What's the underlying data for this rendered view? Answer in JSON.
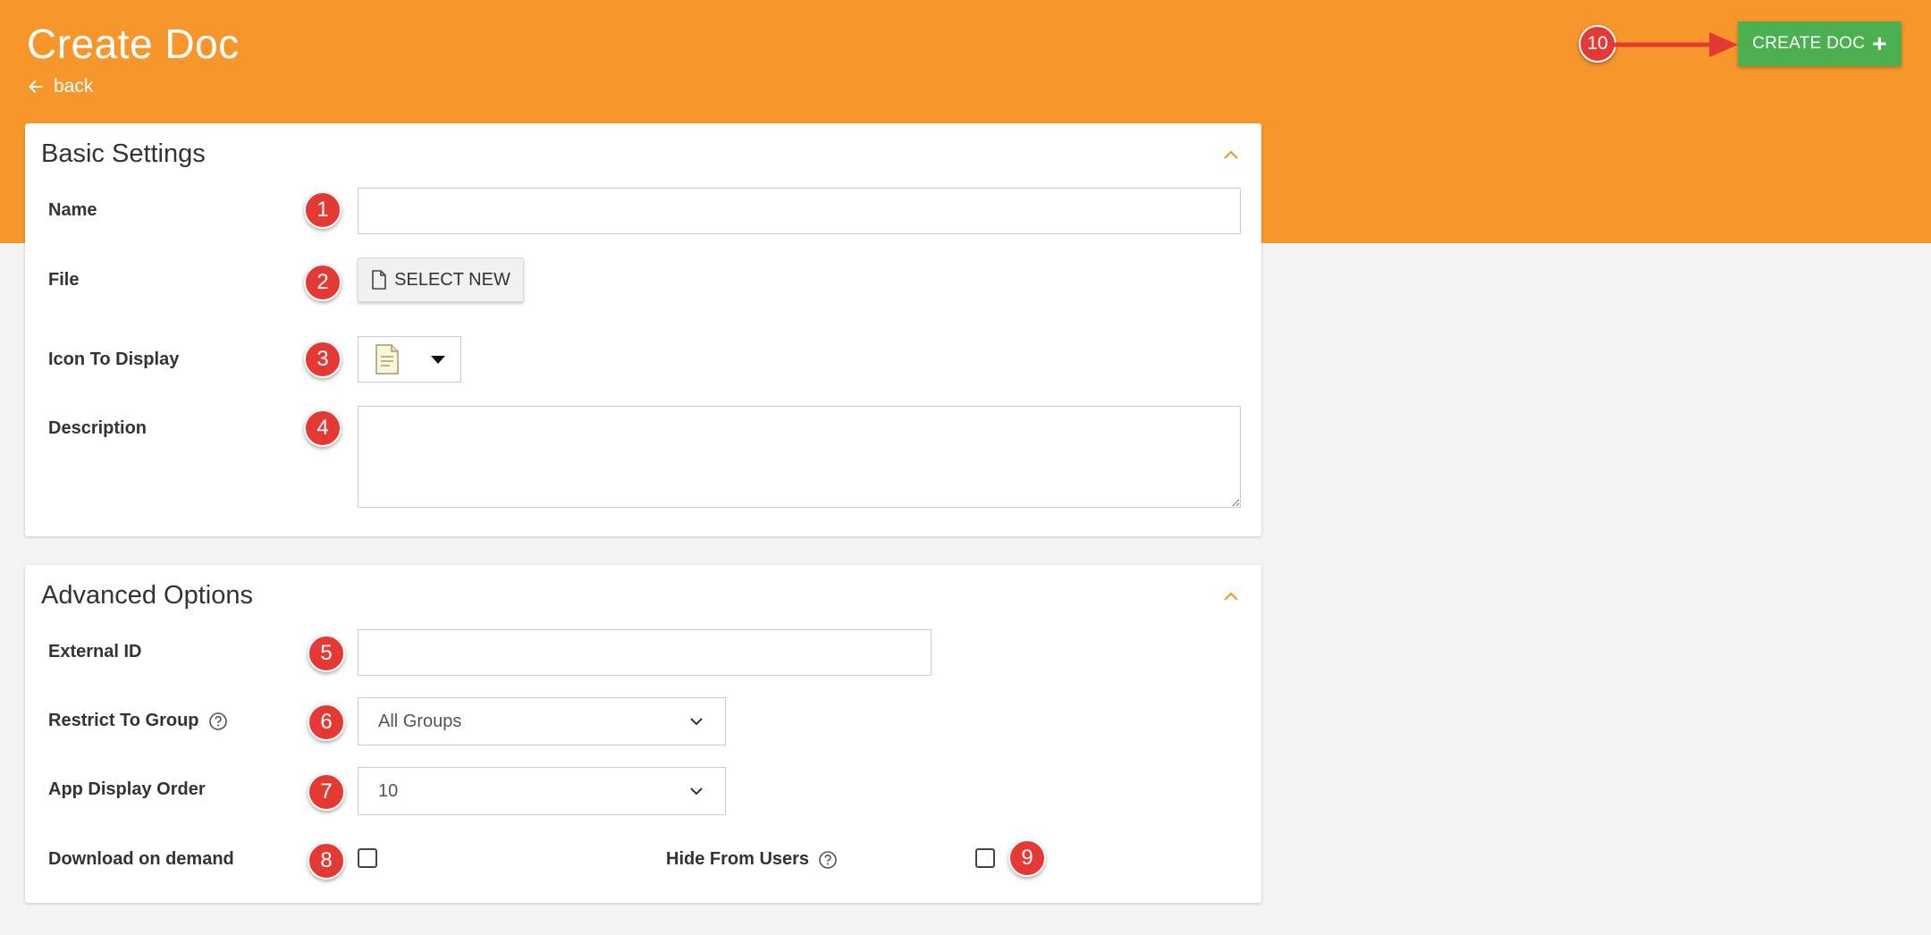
{
  "header": {
    "title": "Create Doc",
    "back_label": "back",
    "create_button_label": "CREATE DOC"
  },
  "basic_settings": {
    "title": "Basic Settings",
    "name_label": "Name",
    "name_value": "",
    "file_label": "File",
    "select_new_label": "SELECT NEW",
    "icon_label": "Icon To Display",
    "description_label": "Description",
    "description_value": ""
  },
  "advanced_options": {
    "title": "Advanced Options",
    "external_id_label": "External ID",
    "external_id_value": "",
    "restrict_label": "Restrict To Group",
    "restrict_value": "All Groups",
    "order_label": "App Display Order",
    "order_value": "10",
    "download_label": "Download on demand",
    "download_checked": false,
    "hide_label": "Hide From Users",
    "hide_checked": false
  },
  "markers": [
    "1",
    "2",
    "3",
    "4",
    "5",
    "6",
    "7",
    "8",
    "9",
    "10"
  ],
  "colors": {
    "header_orange": "#f7962b",
    "create_green": "#4caf50",
    "marker_red": "#e53935",
    "collapse_orange": "#f7962b"
  },
  "icons": [
    "arrow-left-icon",
    "plus-icon",
    "chevron-up-icon",
    "file-icon",
    "document-icon",
    "caret-down-icon",
    "chevron-down-icon",
    "help-circle-icon"
  ]
}
